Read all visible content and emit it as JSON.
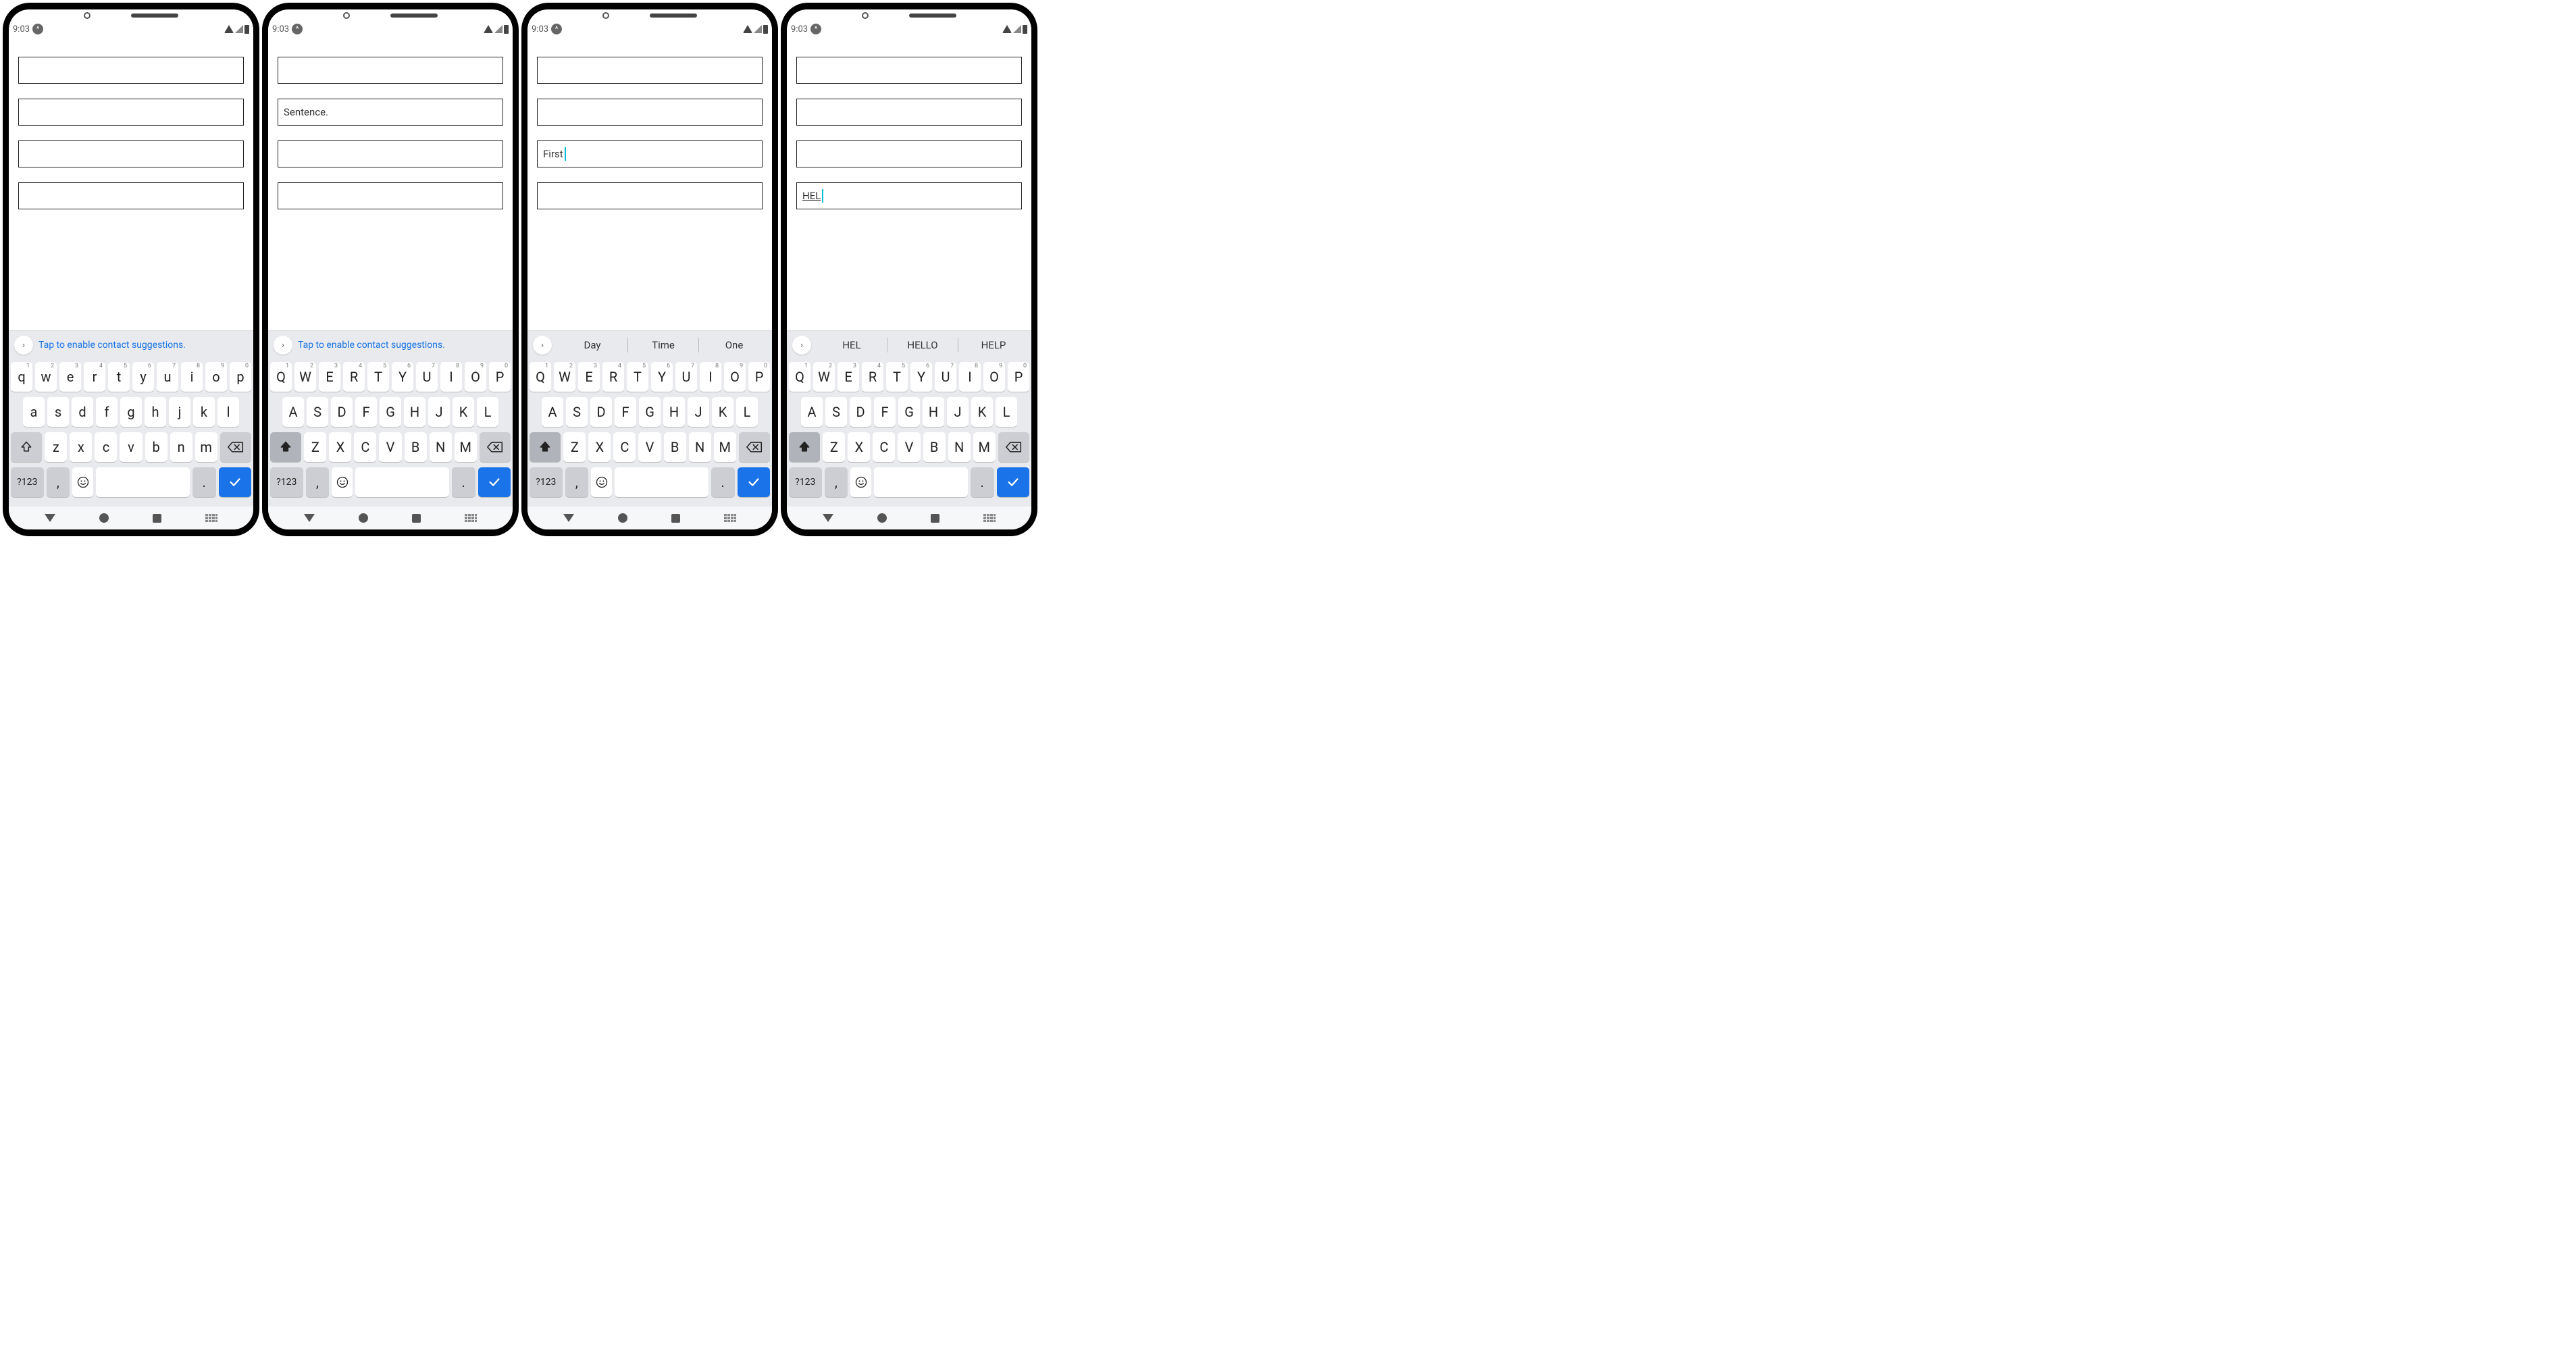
{
  "status": {
    "time": "9:03"
  },
  "phones": [
    {
      "fields": [
        {
          "value": ""
        },
        {
          "value": ""
        },
        {
          "value": ""
        },
        {
          "value": ""
        }
      ],
      "cursor_field": null,
      "suggestions": {
        "mode": "hint",
        "hint": "Tap to enable contact suggestions.",
        "words": []
      },
      "keyboard_case": "lower",
      "shift_active": false
    },
    {
      "fields": [
        {
          "value": ""
        },
        {
          "value": "Sentence."
        },
        {
          "value": ""
        },
        {
          "value": ""
        }
      ],
      "cursor_field": null,
      "suggestions": {
        "mode": "hint",
        "hint": "Tap to enable contact suggestions.",
        "words": []
      },
      "keyboard_case": "upper",
      "shift_active": true
    },
    {
      "fields": [
        {
          "value": ""
        },
        {
          "value": ""
        },
        {
          "value": "First"
        },
        {
          "value": ""
        }
      ],
      "cursor_field": 2,
      "suggestions": {
        "mode": "words",
        "hint": "",
        "words": [
          "Day",
          "Time",
          "One"
        ]
      },
      "keyboard_case": "upper",
      "shift_active": true
    },
    {
      "fields": [
        {
          "value": ""
        },
        {
          "value": ""
        },
        {
          "value": ""
        },
        {
          "value": "HEL",
          "underline": true
        }
      ],
      "cursor_field": 3,
      "suggestions": {
        "mode": "words",
        "hint": "",
        "words": [
          "HEL",
          "HELLO",
          "HELP"
        ]
      },
      "keyboard_case": "upper",
      "shift_active": true
    }
  ],
  "keyboard": {
    "rows_lower": [
      [
        {
          "k": "q",
          "s": "1"
        },
        {
          "k": "w",
          "s": "2"
        },
        {
          "k": "e",
          "s": "3"
        },
        {
          "k": "r",
          "s": "4"
        },
        {
          "k": "t",
          "s": "5"
        },
        {
          "k": "y",
          "s": "6"
        },
        {
          "k": "u",
          "s": "7"
        },
        {
          "k": "i",
          "s": "8"
        },
        {
          "k": "o",
          "s": "9"
        },
        {
          "k": "p",
          "s": "0"
        }
      ],
      [
        {
          "k": "a"
        },
        {
          "k": "s"
        },
        {
          "k": "d"
        },
        {
          "k": "f"
        },
        {
          "k": "g"
        },
        {
          "k": "h"
        },
        {
          "k": "j"
        },
        {
          "k": "k"
        },
        {
          "k": "l"
        }
      ],
      [
        {
          "k": "z"
        },
        {
          "k": "x"
        },
        {
          "k": "c"
        },
        {
          "k": "v"
        },
        {
          "k": "b"
        },
        {
          "k": "n"
        },
        {
          "k": "m"
        }
      ]
    ],
    "rows_upper": [
      [
        {
          "k": "Q",
          "s": "1"
        },
        {
          "k": "W",
          "s": "2"
        },
        {
          "k": "E",
          "s": "3"
        },
        {
          "k": "R",
          "s": "4"
        },
        {
          "k": "T",
          "s": "5"
        },
        {
          "k": "Y",
          "s": "6"
        },
        {
          "k": "U",
          "s": "7"
        },
        {
          "k": "I",
          "s": "8"
        },
        {
          "k": "O",
          "s": "9"
        },
        {
          "k": "P",
          "s": "0"
        }
      ],
      [
        {
          "k": "A"
        },
        {
          "k": "S"
        },
        {
          "k": "D"
        },
        {
          "k": "F"
        },
        {
          "k": "G"
        },
        {
          "k": "H"
        },
        {
          "k": "J"
        },
        {
          "k": "K"
        },
        {
          "k": "L"
        }
      ],
      [
        {
          "k": "Z"
        },
        {
          "k": "X"
        },
        {
          "k": "C"
        },
        {
          "k": "V"
        },
        {
          "k": "B"
        },
        {
          "k": "N"
        },
        {
          "k": "M"
        }
      ]
    ],
    "symbol_key": "?123",
    "comma_key": ",",
    "period_key": "."
  }
}
